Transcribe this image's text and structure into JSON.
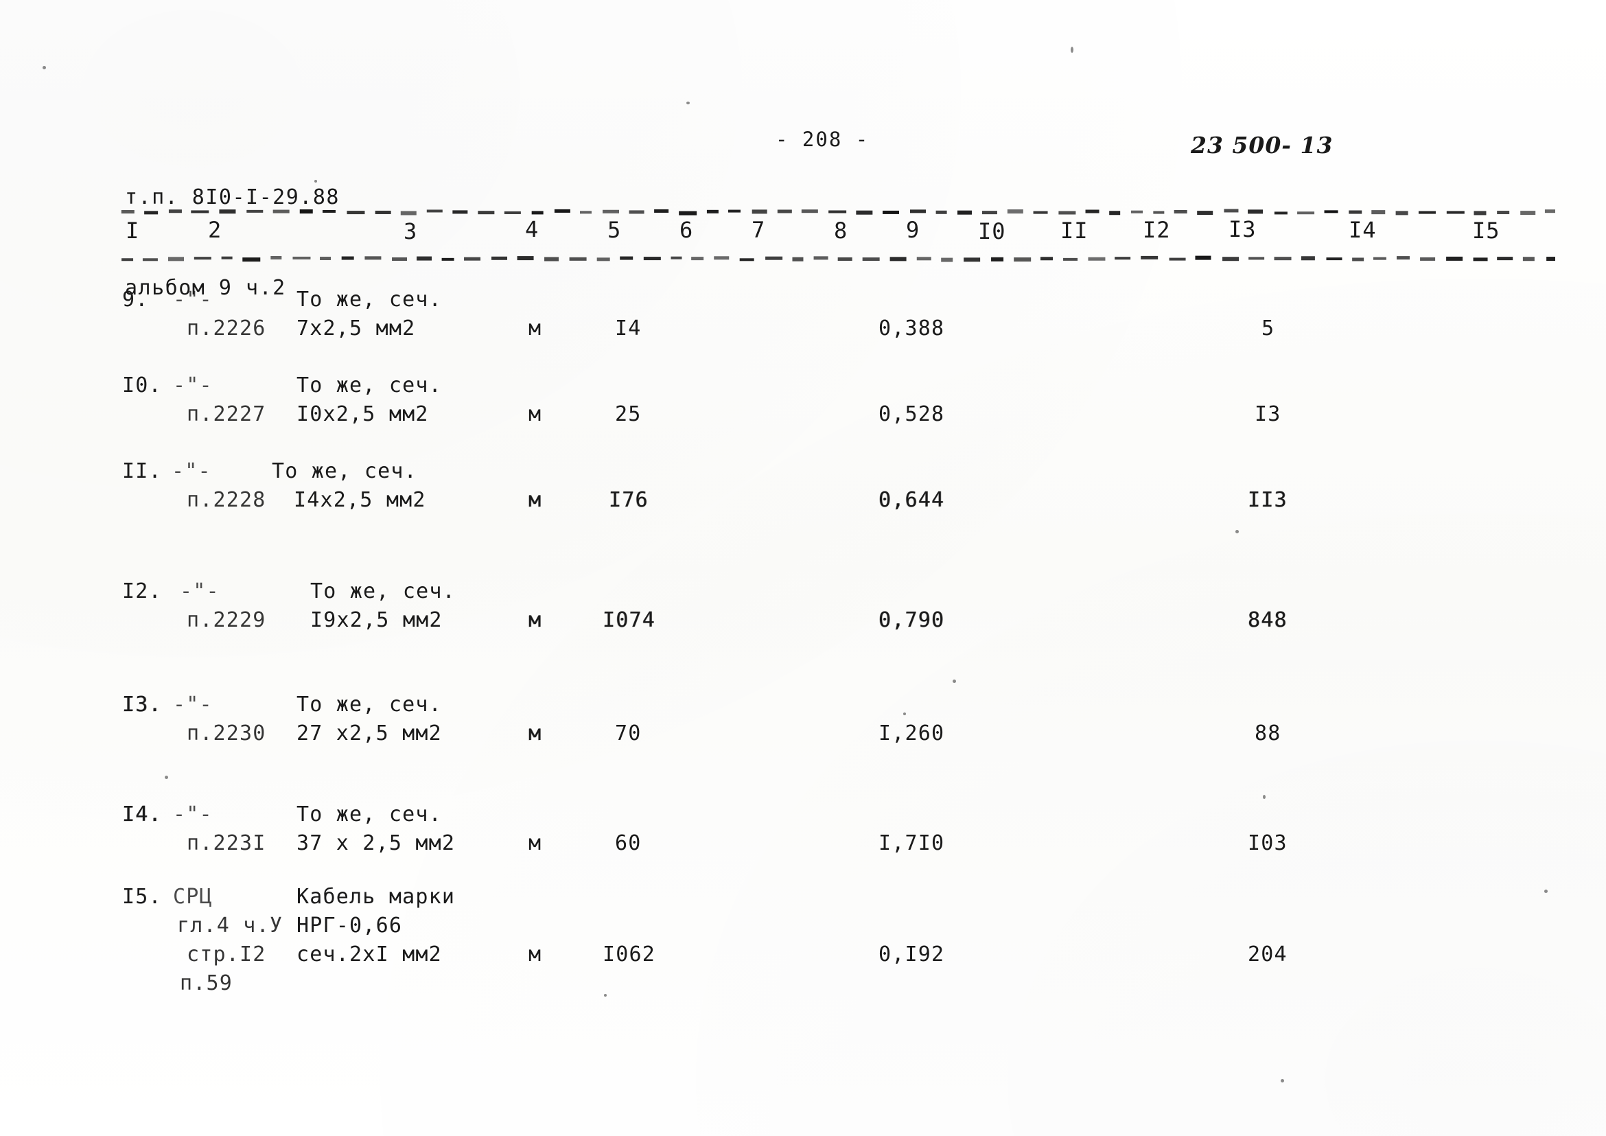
{
  "document": {
    "header_line_1": "т.п. 8I0-I-29.88",
    "header_line_2": "альбом 9 ч.2",
    "page_number": "- 208 -",
    "sheet_code": "23 500- 13"
  },
  "table": {
    "column_numbers": [
      "I",
      "2",
      "3",
      "4",
      "5",
      "6",
      "7",
      "8",
      "9",
      "I0",
      "II",
      "I2",
      "I3",
      "I4",
      "I5"
    ],
    "rows": [
      {
        "num": "9.",
        "ref_mark": "-\"-",
        "ref_item": "п.2226",
        "name_line_1": "То же, сеч.",
        "name_line_2": "7х2,5 мм2",
        "unit": "м",
        "qty": "I4",
        "mass": "0,388",
        "total": "5"
      },
      {
        "num": "I0.",
        "ref_mark": "-\"-",
        "ref_item": "п.2227",
        "name_line_1": "То же, сеч.",
        "name_line_2": "I0х2,5 мм2",
        "unit": "м",
        "qty": "25",
        "mass": "0,528",
        "total": "I3"
      },
      {
        "num": "II.",
        "ref_mark": "-\"-",
        "ref_item": "п.2228",
        "name_line_1": "То же, сеч.",
        "name_line_2": "I4х2,5 мм2",
        "unit": "м",
        "qty": "I76",
        "mass": "0,644",
        "total": "II3"
      },
      {
        "num": "I2.",
        "ref_mark": "-\"-",
        "ref_item": "п.2229",
        "name_line_1": "То же, сеч.",
        "name_line_2": "I9х2,5 мм2",
        "unit": "м",
        "qty": "I074",
        "mass": "0,790",
        "total": "848"
      },
      {
        "num": "I3.",
        "ref_mark": "-\"-",
        "ref_item": "п.2230",
        "name_line_1": "То же, сеч.",
        "name_line_2": "27 х2,5 мм2",
        "unit": "м",
        "qty": "70",
        "mass": "I,260",
        "total": "88"
      },
      {
        "num": "I4.",
        "ref_mark": "-\"-",
        "ref_item": "п.223I",
        "name_line_1": "То же, сеч.",
        "name_line_2": "37 х 2,5 мм2",
        "unit": "м",
        "qty": "60",
        "mass": "I,7I0",
        "total": "I03"
      },
      {
        "num": "I5.",
        "ref_mark": "СРЦ",
        "ref_line_2": "гл.4 ч.У",
        "ref_line_3": "стр.I2",
        "ref_line_4": "п.59",
        "name_line_1": "Кабель марки",
        "name_line_2": "НРГ-0,66",
        "name_line_3": "сеч.2хI мм2",
        "unit": "м",
        "qty": "I062",
        "mass": "0,I92",
        "total": "204"
      }
    ]
  }
}
